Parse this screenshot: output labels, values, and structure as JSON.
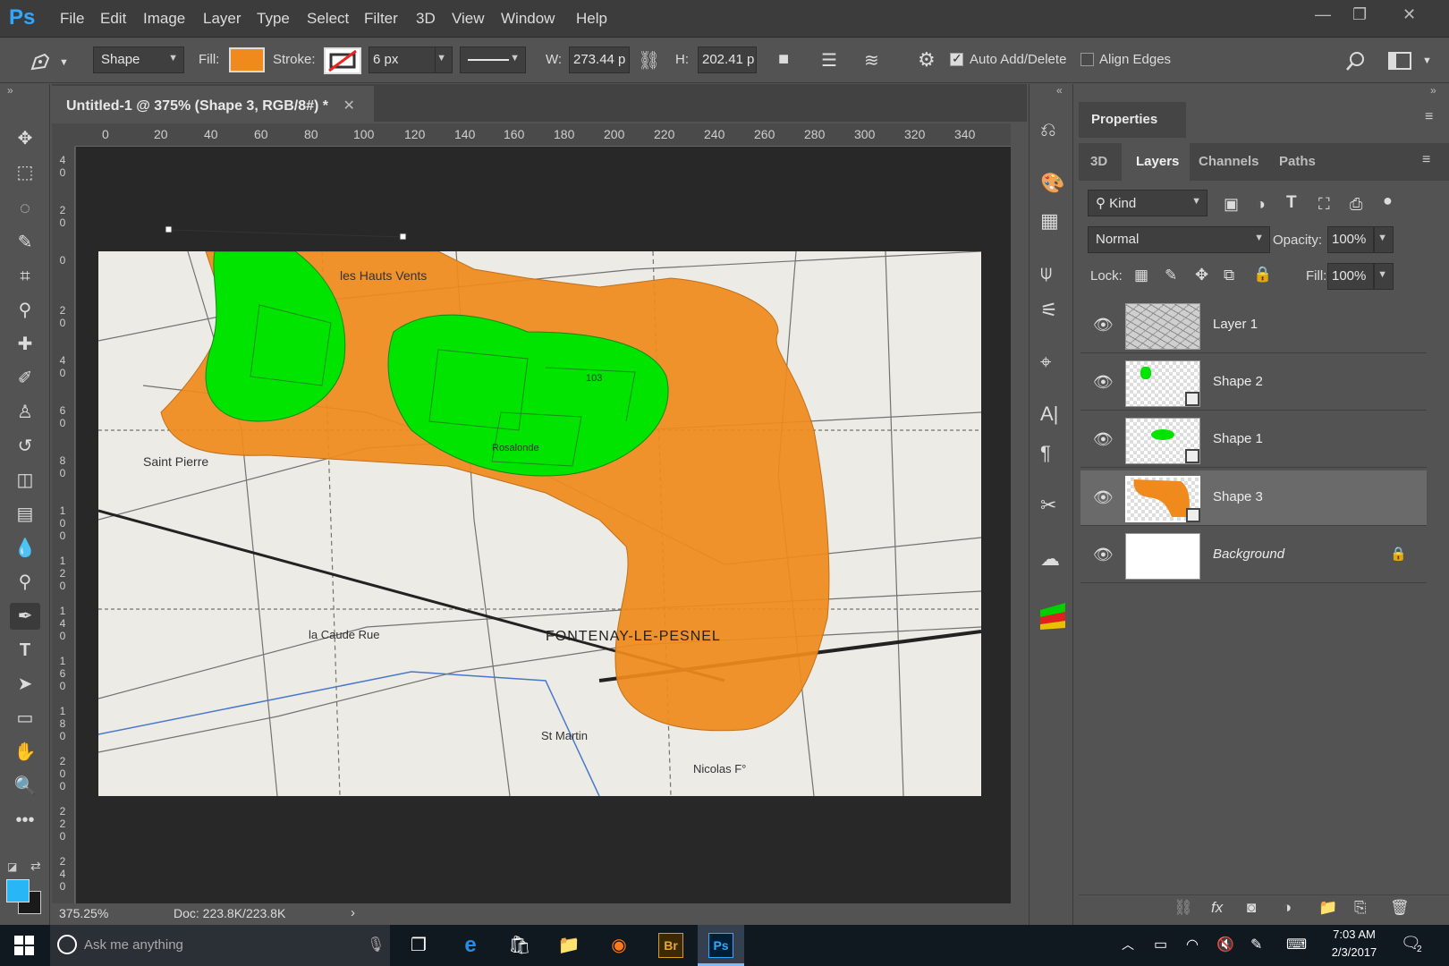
{
  "app": {
    "logo": "Ps"
  },
  "menu": [
    "File",
    "Edit",
    "Image",
    "Layer",
    "Type",
    "Select",
    "Filter",
    "3D",
    "View",
    "Window",
    "Help"
  ],
  "options": {
    "mode": "Shape",
    "fill_label": "Fill:",
    "fill_color": "#f08a1c",
    "stroke_label": "Stroke:",
    "stroke_size": "6 px",
    "w_label": "W:",
    "w_value": "273.44 p",
    "h_label": "H:",
    "h_value": "202.41 p",
    "auto_add_delete": "Auto Add/Delete",
    "align_edges": "Align Edges"
  },
  "document": {
    "tab_title": "Untitled-1 @ 375% (Shape 3, RGB/8#) *",
    "zoom": "375.25%",
    "doc_size": "Doc: 223.8K/223.8K"
  },
  "ruler_h": [
    "0",
    "20",
    "40",
    "60",
    "80",
    "100",
    "120",
    "140",
    "160",
    "180",
    "200",
    "220",
    "240",
    "260",
    "280",
    "300",
    "320",
    "340"
  ],
  "ruler_v": [
    "4\n0",
    "2\n0",
    "0",
    "2\n0",
    "4\n0",
    "6\n0",
    "8\n0",
    "1\n0\n0",
    "1\n2\n0",
    "1\n4\n0",
    "1\n6\n0",
    "1\n8\n0",
    "2\n0\n0",
    "2\n2\n0",
    "2\n4\n0"
  ],
  "map_labels": [
    "les Hauts Vents",
    "Saint Pierre",
    "FONTENAY-LE-PESNEL",
    "la Caude Rue",
    "St Martin",
    "Nicolas F°",
    "103",
    "Rosalonde"
  ],
  "panel": {
    "properties": "Properties",
    "tabs": [
      "3D",
      "Layers",
      "Channels",
      "Paths"
    ],
    "kind": "Kind",
    "blend_mode": "Normal",
    "opacity_label": "Opacity:",
    "opacity_value": "100%",
    "lock_label": "Lock:",
    "fill_label": "Fill:",
    "fill_value": "100%",
    "layers": [
      {
        "name": "Layer 1"
      },
      {
        "name": "Shape 2"
      },
      {
        "name": "Shape 1"
      },
      {
        "name": "Shape 3"
      },
      {
        "name": "Background"
      }
    ]
  },
  "taskbar": {
    "search_placeholder": "Ask me anything",
    "time": "7:03 AM",
    "date": "2/3/2017",
    "notification_count": "2"
  },
  "colors": {
    "orange": "#f08a1c",
    "green": "#00e400",
    "foreground": "#29b6f6",
    "background": "#1a1a1a"
  }
}
